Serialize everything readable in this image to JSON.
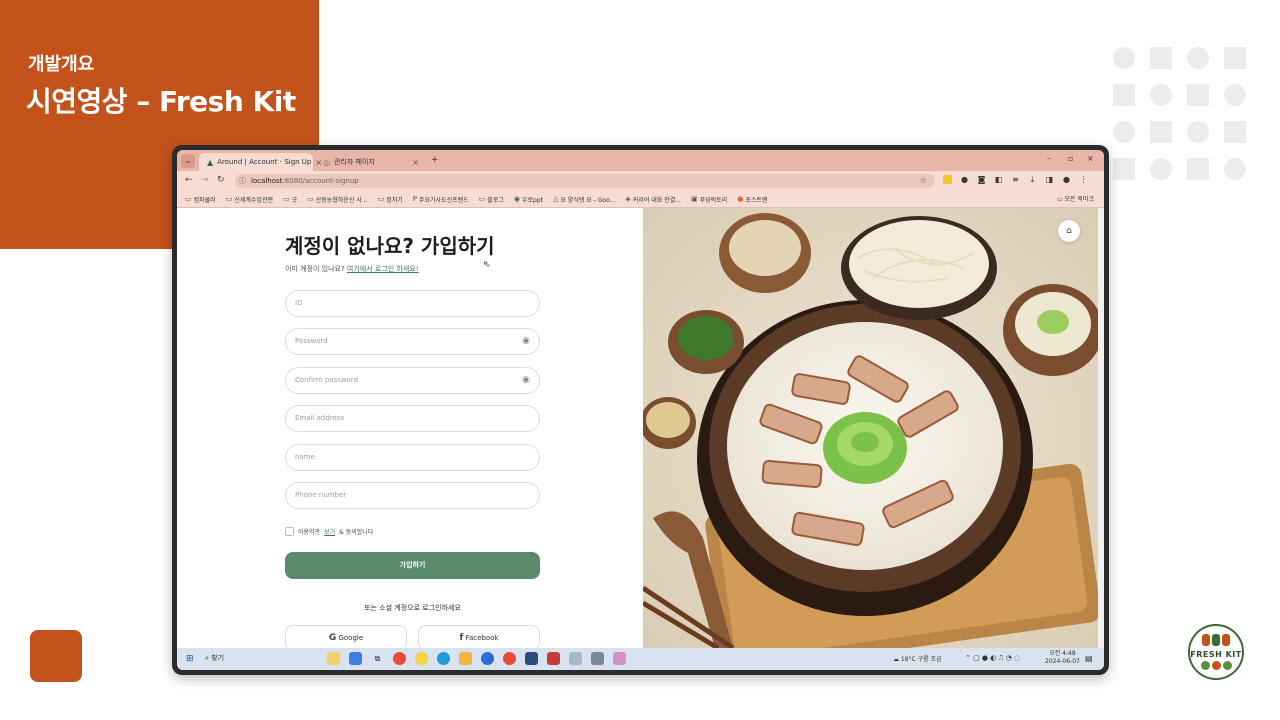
{
  "slide": {
    "section": "개발개요",
    "title": "시연영상 – Fresh Kit",
    "logo_text": "FRESH KIT"
  },
  "browser": {
    "tabs": [
      {
        "label": "Around | Account - Sign Up",
        "active": true
      },
      {
        "label": "관리자 페이지",
        "active": false
      }
    ],
    "url_host": "localhost",
    "url_path": ":8080/account-signup",
    "bookmarks": [
      "컴파쿨러",
      "신세계수업관련",
      "굿",
      "산동농협하운신 사...",
      "정처기",
      "주요기사도신프렌드",
      "블로그",
      "우로ppt",
      "요 양식탱 요 - Goo...",
      "커리어 대화 안결...",
      "푸딩럭토리",
      "포스트맨"
    ],
    "all_bookmarks": "모든 북마크"
  },
  "form": {
    "title": "계정이 없나요? 가입하기",
    "subtitle_prefix": "이미 계정이 있나요?",
    "login_link": "여기에서 로그인 하세요!",
    "fields": {
      "id": "ID",
      "password": "Password",
      "confirm": "Confirm password",
      "email": "Email address",
      "name": "name",
      "phone": "Phone number"
    },
    "terms_prefix": "이용약관",
    "terms_link": "보기",
    "terms_suffix": "& 동의합니다",
    "submit": "가입하기",
    "social_label": "또는 소셜 계정으로 로그인하세요",
    "google": "Google",
    "facebook": "Facebook"
  },
  "taskbar": {
    "search": "찾기",
    "weather": "18°C 구름 조금",
    "time": "오전 4:48",
    "date": "2024-06-07"
  },
  "colors": {
    "accent_orange": "#c3521b",
    "button_green": "#5a8b6c",
    "chrome_tab": "#e8b6a9"
  }
}
